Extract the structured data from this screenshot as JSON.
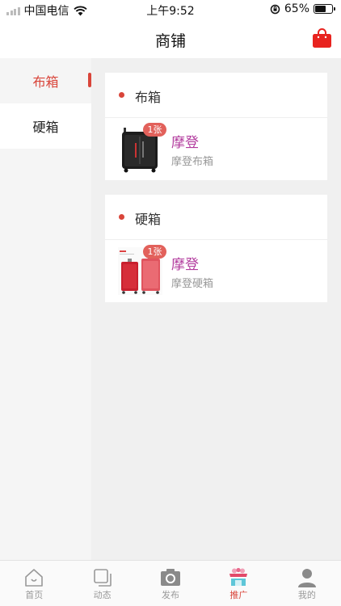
{
  "status": {
    "carrier": "中国电信",
    "time": "上午9:52",
    "battery": "65%",
    "battery_level": 0.65
  },
  "nav": {
    "title": "商铺",
    "bag_icon": "shopping-bag-icon",
    "accent": "#e8231f"
  },
  "sidebar": {
    "items": [
      {
        "label": "布箱",
        "active": true
      },
      {
        "label": "硬箱",
        "active": false
      }
    ],
    "active_color": "#d9453a"
  },
  "sections": [
    {
      "title": "布箱",
      "products": [
        {
          "count": "1张",
          "name": "摩登",
          "desc": "摩登布箱"
        }
      ]
    },
    {
      "title": "硬箱",
      "products": [
        {
          "count": "1张",
          "name": "摩登",
          "desc": "摩登硬箱"
        }
      ]
    }
  ],
  "tabbar": {
    "items": [
      {
        "label": "首页",
        "icon": "home-icon",
        "active": false
      },
      {
        "label": "动态",
        "icon": "square-stack-icon",
        "active": false
      },
      {
        "label": "发布",
        "icon": "camera-icon",
        "active": false
      },
      {
        "label": "推广",
        "icon": "storefront-icon",
        "active": true
      },
      {
        "label": "我的",
        "icon": "person-icon",
        "active": false
      }
    ]
  }
}
